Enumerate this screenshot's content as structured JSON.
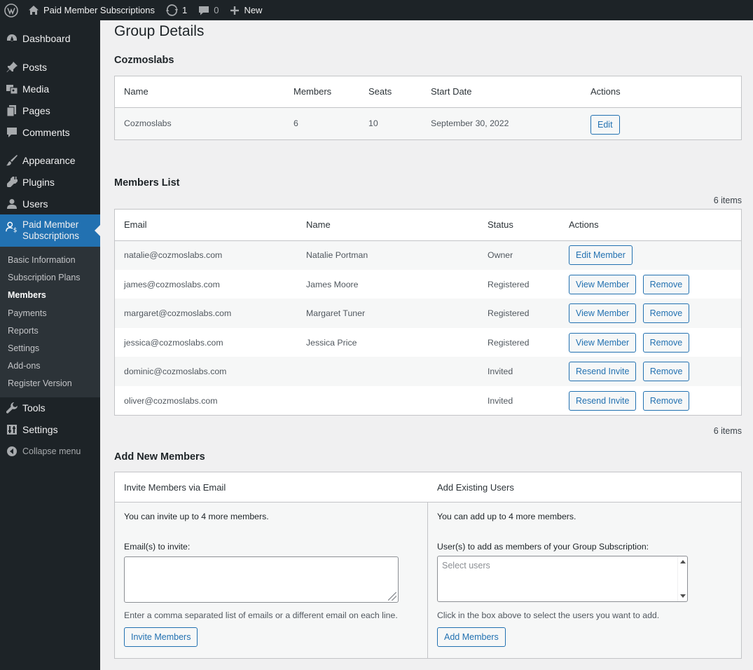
{
  "adminbar": {
    "site_name": "Paid Member Subscriptions",
    "updates_count": "1",
    "comments_count": "0",
    "new_label": "New"
  },
  "sidebar": {
    "items_top": [
      {
        "label": "Dashboard",
        "icon": "dashboard-icon"
      }
    ],
    "items_group2": [
      {
        "label": "Posts",
        "icon": "pin-icon"
      },
      {
        "label": "Media",
        "icon": "media-icon"
      },
      {
        "label": "Pages",
        "icon": "pages-icon"
      },
      {
        "label": "Comments",
        "icon": "comment-icon"
      }
    ],
    "items_group3": [
      {
        "label": "Appearance",
        "icon": "brush-icon"
      },
      {
        "label": "Plugins",
        "icon": "plug-icon"
      },
      {
        "label": "Users",
        "icon": "user-icon"
      }
    ],
    "current": {
      "label_line1": "Paid Member",
      "label_line2": "Subscriptions",
      "icon": "member-subscriptions-icon"
    },
    "submenu": [
      "Basic Information",
      "Subscription Plans",
      "Members",
      "Payments",
      "Reports",
      "Settings",
      "Add-ons",
      "Register Version"
    ],
    "submenu_active": "Members",
    "items_bottom": [
      {
        "label": "Tools",
        "icon": "wrench-icon"
      },
      {
        "label": "Settings",
        "icon": "settings-icon"
      }
    ],
    "collapse_label": "Collapse menu"
  },
  "page": {
    "title": "Group Details",
    "group_name": "Cozmoslabs",
    "group_table": {
      "headers": [
        "Name",
        "Members",
        "Seats",
        "Start Date",
        "Actions"
      ],
      "row": {
        "name": "Cozmoslabs",
        "members": "6",
        "seats": "10",
        "start_date": "September 30, 2022",
        "action": "Edit"
      }
    },
    "members_list": {
      "title": "Members List",
      "count_label": "6 items",
      "headers": [
        "Email",
        "Name",
        "Status",
        "Actions"
      ],
      "rows": [
        {
          "email": "natalie@cozmoslabs.com",
          "name": "Natalie Portman",
          "status": "Owner",
          "primary": "Edit Member",
          "secondary": ""
        },
        {
          "email": "james@cozmoslabs.com",
          "name": "James Moore",
          "status": "Registered",
          "primary": "View Member",
          "secondary": "Remove"
        },
        {
          "email": "margaret@cozmoslabs.com",
          "name": "Margaret Tuner",
          "status": "Registered",
          "primary": "View Member",
          "secondary": "Remove"
        },
        {
          "email": "jessica@cozmoslabs.com",
          "name": "Jessica Price",
          "status": "Registered",
          "primary": "View Member",
          "secondary": "Remove"
        },
        {
          "email": "dominic@cozmoslabs.com",
          "name": "",
          "status": "Invited",
          "primary": "Resend Invite",
          "secondary": "Remove"
        },
        {
          "email": "oliver@cozmoslabs.com",
          "name": "",
          "status": "Invited",
          "primary": "Resend Invite",
          "secondary": "Remove"
        }
      ]
    },
    "add_new": {
      "title": "Add New Members",
      "invite": {
        "heading": "Invite Members via Email",
        "info": "You can invite up to 4 more members.",
        "field_label": "Email(s) to invite:",
        "field_value": "",
        "hint": "Enter a comma separated list of emails or a different email on each line.",
        "button": "Invite Members"
      },
      "existing": {
        "heading": "Add Existing Users",
        "info": "You can add up to 4 more members.",
        "field_label": "User(s) to add as members of your Group Subscription:",
        "placeholder": "Select users",
        "hint": "Click in the box above to select the users you want to add.",
        "button": "Add Members"
      }
    }
  }
}
